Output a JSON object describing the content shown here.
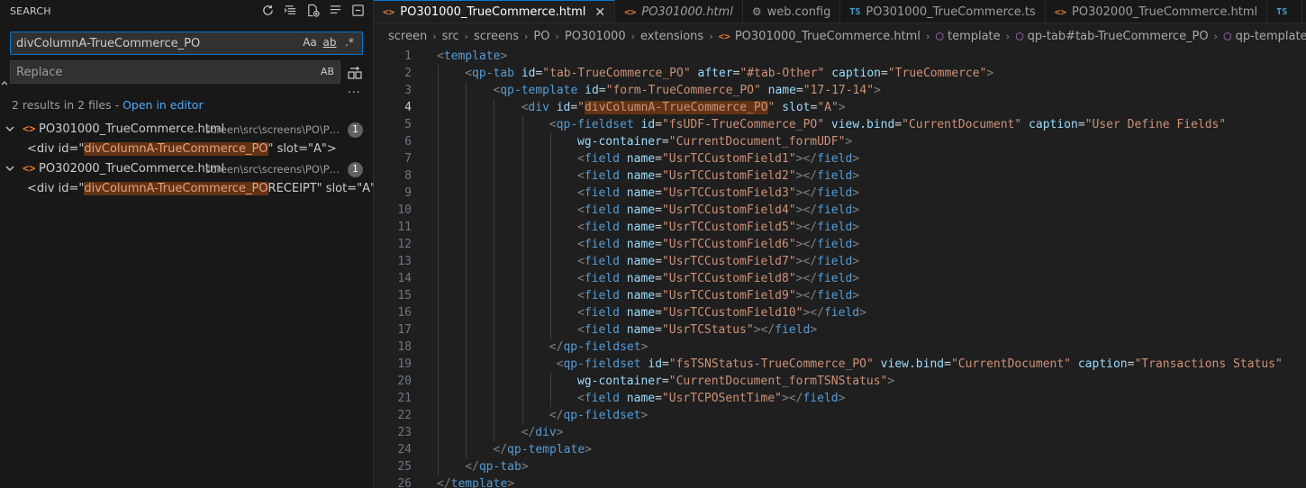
{
  "sidebar": {
    "title": "SEARCH",
    "search_value": "divColumnA-TrueCommerce_PO",
    "search_options": [
      "Aa",
      "ab",
      ".*"
    ],
    "replace_placeholder": "Replace",
    "replace_option": "AB",
    "more": "...",
    "results_text": "2 results in 2 files - ",
    "open_in_editor": "Open in editor",
    "files": [
      {
        "name": "PO301000_TrueCommerce.html",
        "path": "screen\\src\\screens\\PO\\PO3...",
        "count": "1",
        "match_prefix": "<div id=\"",
        "match_hl": "divColumnA-TrueCommerce_PO",
        "match_suffix": "\" slot=\"A\">"
      },
      {
        "name": "PO302000_TrueCommerce.html",
        "path": "screen\\src\\screens\\PO\\PO3...",
        "count": "1",
        "match_prefix": "<div id=\"",
        "match_hl": "divColumnA-TrueCommerce_PO",
        "match_suffix": "RECEIPT\" slot=\"A\">"
      }
    ]
  },
  "tabs": [
    {
      "icon": "<>",
      "icon_type": "html",
      "label": "PO301000_TrueCommerce.html",
      "active": true,
      "italic": false
    },
    {
      "icon": "<>",
      "icon_type": "html",
      "label": "PO301000.html",
      "active": false,
      "italic": true
    },
    {
      "icon": "⚙",
      "icon_type": "gear",
      "label": "web.config",
      "active": false,
      "italic": false
    },
    {
      "icon": "TS",
      "icon_type": "ts",
      "label": "PO301000_TrueCommerce.ts",
      "active": false,
      "italic": false
    },
    {
      "icon": "<>",
      "icon_type": "html",
      "label": "PO302000_TrueCommerce.html",
      "active": false,
      "italic": false
    },
    {
      "icon": "TS",
      "icon_type": "ts",
      "label": "",
      "active": false,
      "italic": false
    }
  ],
  "breadcrumb": [
    "screen",
    "src",
    "screens",
    "PO",
    "PO301000",
    "extensions",
    "PO301000_TrueCommerce.html",
    "template",
    "qp-tab#tab-TrueCommerce_PO",
    "qp-template#form-TrueCo"
  ],
  "current_line": 4,
  "code_lines": [
    {
      "n": "1",
      "indent": 0,
      "tokens": [
        [
          "br",
          "<"
        ],
        [
          "tag",
          "template"
        ],
        [
          "br",
          ">"
        ]
      ]
    },
    {
      "n": "2",
      "indent": 1,
      "tokens": [
        [
          "br",
          "<"
        ],
        [
          "tag",
          "qp-tab"
        ],
        [
          "sp",
          " "
        ],
        [
          "attr",
          "id"
        ],
        [
          "eq",
          "="
        ],
        [
          "str",
          "\"tab-TrueCommerce_PO\""
        ],
        [
          "sp",
          " "
        ],
        [
          "attr",
          "after"
        ],
        [
          "eq",
          "="
        ],
        [
          "str",
          "\"#tab-Other\""
        ],
        [
          "sp",
          " "
        ],
        [
          "attr",
          "caption"
        ],
        [
          "eq",
          "="
        ],
        [
          "str",
          "\"TrueCommerce\""
        ],
        [
          "br",
          ">"
        ]
      ]
    },
    {
      "n": "3",
      "indent": 2,
      "tokens": [
        [
          "br",
          "<"
        ],
        [
          "tag",
          "qp-template"
        ],
        [
          "sp",
          " "
        ],
        [
          "attr",
          "id"
        ],
        [
          "eq",
          "="
        ],
        [
          "str",
          "\"form-TrueCommerce_PO\""
        ],
        [
          "sp",
          " "
        ],
        [
          "attr",
          "name"
        ],
        [
          "eq",
          "="
        ],
        [
          "str",
          "\"17-17-14\""
        ],
        [
          "br",
          ">"
        ]
      ]
    },
    {
      "n": "4",
      "indent": 3,
      "tokens": [
        [
          "br",
          "<"
        ],
        [
          "tag",
          "div"
        ],
        [
          "sp",
          " "
        ],
        [
          "attr",
          "id"
        ],
        [
          "eq",
          "="
        ],
        [
          "str",
          "\""
        ],
        [
          "hl",
          "divColumnA-TrueCommerce_PO"
        ],
        [
          "str",
          "\""
        ],
        [
          "sp",
          " "
        ],
        [
          "attr",
          "slot"
        ],
        [
          "eq",
          "="
        ],
        [
          "str",
          "\"A\""
        ],
        [
          "br",
          ">"
        ]
      ]
    },
    {
      "n": "5",
      "indent": 4,
      "tokens": [
        [
          "br",
          "<"
        ],
        [
          "tag",
          "qp-fieldset"
        ],
        [
          "sp",
          " "
        ],
        [
          "attr",
          "id"
        ],
        [
          "eq",
          "="
        ],
        [
          "str",
          "\"fsUDF-TrueCommerce_PO\""
        ],
        [
          "sp",
          " "
        ],
        [
          "attr",
          "view.bind"
        ],
        [
          "eq",
          "="
        ],
        [
          "str",
          "\"CurrentDocument\""
        ],
        [
          "sp",
          " "
        ],
        [
          "attr",
          "caption"
        ],
        [
          "eq",
          "="
        ],
        [
          "str",
          "\"User Define Fields\""
        ]
      ]
    },
    {
      "n": "6",
      "indent": 5,
      "tokens": [
        [
          "attr",
          "wg-container"
        ],
        [
          "eq",
          "="
        ],
        [
          "str",
          "\"CurrentDocument_formUDF\""
        ],
        [
          "br",
          ">"
        ]
      ]
    },
    {
      "n": "7",
      "indent": 5,
      "tokens": [
        [
          "br",
          "<"
        ],
        [
          "tag",
          "field"
        ],
        [
          "sp",
          " "
        ],
        [
          "attr",
          "name"
        ],
        [
          "eq",
          "="
        ],
        [
          "str",
          "\"UsrTCCustomField1\""
        ],
        [
          "br",
          "></"
        ],
        [
          "tag",
          "field"
        ],
        [
          "br",
          ">"
        ]
      ]
    },
    {
      "n": "8",
      "indent": 5,
      "tokens": [
        [
          "br",
          "<"
        ],
        [
          "tag",
          "field"
        ],
        [
          "sp",
          " "
        ],
        [
          "attr",
          "name"
        ],
        [
          "eq",
          "="
        ],
        [
          "str",
          "\"UsrTCCustomField2\""
        ],
        [
          "br",
          "></"
        ],
        [
          "tag",
          "field"
        ],
        [
          "br",
          ">"
        ]
      ]
    },
    {
      "n": "9",
      "indent": 5,
      "tokens": [
        [
          "br",
          "<"
        ],
        [
          "tag",
          "field"
        ],
        [
          "sp",
          " "
        ],
        [
          "attr",
          "name"
        ],
        [
          "eq",
          "="
        ],
        [
          "str",
          "\"UsrTCCustomField3\""
        ],
        [
          "br",
          "></"
        ],
        [
          "tag",
          "field"
        ],
        [
          "br",
          ">"
        ]
      ]
    },
    {
      "n": "10",
      "indent": 5,
      "tokens": [
        [
          "br",
          "<"
        ],
        [
          "tag",
          "field"
        ],
        [
          "sp",
          " "
        ],
        [
          "attr",
          "name"
        ],
        [
          "eq",
          "="
        ],
        [
          "str",
          "\"UsrTCCustomField4\""
        ],
        [
          "br",
          "></"
        ],
        [
          "tag",
          "field"
        ],
        [
          "br",
          ">"
        ]
      ]
    },
    {
      "n": "11",
      "indent": 5,
      "tokens": [
        [
          "br",
          "<"
        ],
        [
          "tag",
          "field"
        ],
        [
          "sp",
          " "
        ],
        [
          "attr",
          "name"
        ],
        [
          "eq",
          "="
        ],
        [
          "str",
          "\"UsrTCCustomField5\""
        ],
        [
          "br",
          "></"
        ],
        [
          "tag",
          "field"
        ],
        [
          "br",
          ">"
        ]
      ]
    },
    {
      "n": "12",
      "indent": 5,
      "tokens": [
        [
          "br",
          "<"
        ],
        [
          "tag",
          "field"
        ],
        [
          "sp",
          " "
        ],
        [
          "attr",
          "name"
        ],
        [
          "eq",
          "="
        ],
        [
          "str",
          "\"UsrTCCustomField6\""
        ],
        [
          "br",
          "></"
        ],
        [
          "tag",
          "field"
        ],
        [
          "br",
          ">"
        ]
      ]
    },
    {
      "n": "13",
      "indent": 5,
      "tokens": [
        [
          "br",
          "<"
        ],
        [
          "tag",
          "field"
        ],
        [
          "sp",
          " "
        ],
        [
          "attr",
          "name"
        ],
        [
          "eq",
          "="
        ],
        [
          "str",
          "\"UsrTCCustomField7\""
        ],
        [
          "br",
          "></"
        ],
        [
          "tag",
          "field"
        ],
        [
          "br",
          ">"
        ]
      ]
    },
    {
      "n": "14",
      "indent": 5,
      "tokens": [
        [
          "br",
          "<"
        ],
        [
          "tag",
          "field"
        ],
        [
          "sp",
          " "
        ],
        [
          "attr",
          "name"
        ],
        [
          "eq",
          "="
        ],
        [
          "str",
          "\"UsrTCCustomField8\""
        ],
        [
          "br",
          "></"
        ],
        [
          "tag",
          "field"
        ],
        [
          "br",
          ">"
        ]
      ]
    },
    {
      "n": "15",
      "indent": 5,
      "tokens": [
        [
          "br",
          "<"
        ],
        [
          "tag",
          "field"
        ],
        [
          "sp",
          " "
        ],
        [
          "attr",
          "name"
        ],
        [
          "eq",
          "="
        ],
        [
          "str",
          "\"UsrTCCustomField9\""
        ],
        [
          "br",
          "></"
        ],
        [
          "tag",
          "field"
        ],
        [
          "br",
          ">"
        ]
      ]
    },
    {
      "n": "16",
      "indent": 5,
      "tokens": [
        [
          "br",
          "<"
        ],
        [
          "tag",
          "field"
        ],
        [
          "sp",
          " "
        ],
        [
          "attr",
          "name"
        ],
        [
          "eq",
          "="
        ],
        [
          "str",
          "\"UsrTCCustomField10\""
        ],
        [
          "br",
          "></"
        ],
        [
          "tag",
          "field"
        ],
        [
          "br",
          ">"
        ]
      ]
    },
    {
      "n": "17",
      "indent": 5,
      "tokens": [
        [
          "br",
          "<"
        ],
        [
          "tag",
          "field"
        ],
        [
          "sp",
          " "
        ],
        [
          "attr",
          "name"
        ],
        [
          "eq",
          "="
        ],
        [
          "str",
          "\"UsrTCStatus\""
        ],
        [
          "br",
          "></"
        ],
        [
          "tag",
          "field"
        ],
        [
          "br",
          ">"
        ]
      ]
    },
    {
      "n": "18",
      "indent": 4,
      "tokens": [
        [
          "br",
          "</"
        ],
        [
          "tag",
          "qp-fieldset"
        ],
        [
          "br",
          ">"
        ]
      ]
    },
    {
      "n": "19",
      "indent": 4,
      "lead": " ",
      "tokens": [
        [
          "br",
          "<"
        ],
        [
          "tag",
          "qp-fieldset"
        ],
        [
          "sp",
          " "
        ],
        [
          "attr",
          "id"
        ],
        [
          "eq",
          "="
        ],
        [
          "str",
          "\"fsTSNStatus-TrueCommerce_PO\""
        ],
        [
          "sp",
          " "
        ],
        [
          "attr",
          "view.bind"
        ],
        [
          "eq",
          "="
        ],
        [
          "str",
          "\"CurrentDocument\""
        ],
        [
          "sp",
          " "
        ],
        [
          "attr",
          "caption"
        ],
        [
          "eq",
          "="
        ],
        [
          "str",
          "\"Transactions Status\""
        ]
      ]
    },
    {
      "n": "20",
      "indent": 5,
      "tokens": [
        [
          "attr",
          "wg-container"
        ],
        [
          "eq",
          "="
        ],
        [
          "str",
          "\"CurrentDocument_formTSNStatus\""
        ],
        [
          "br",
          ">"
        ]
      ]
    },
    {
      "n": "21",
      "indent": 5,
      "tokens": [
        [
          "br",
          "<"
        ],
        [
          "tag",
          "field"
        ],
        [
          "sp",
          " "
        ],
        [
          "attr",
          "name"
        ],
        [
          "eq",
          "="
        ],
        [
          "str",
          "\"UsrTCPOSentTime\""
        ],
        [
          "br",
          "></"
        ],
        [
          "tag",
          "field"
        ],
        [
          "br",
          ">"
        ]
      ]
    },
    {
      "n": "22",
      "indent": 4,
      "tokens": [
        [
          "br",
          "</"
        ],
        [
          "tag",
          "qp-fieldset"
        ],
        [
          "br",
          ">"
        ]
      ]
    },
    {
      "n": "23",
      "indent": 3,
      "tokens": [
        [
          "br",
          "</"
        ],
        [
          "tag",
          "div"
        ],
        [
          "br",
          ">"
        ]
      ]
    },
    {
      "n": "24",
      "indent": 2,
      "tokens": [
        [
          "br",
          "</"
        ],
        [
          "tag",
          "qp-template"
        ],
        [
          "br",
          ">"
        ]
      ]
    },
    {
      "n": "25",
      "indent": 1,
      "tokens": [
        [
          "br",
          "</"
        ],
        [
          "tag",
          "qp-tab"
        ],
        [
          "br",
          ">"
        ]
      ]
    },
    {
      "n": "26",
      "indent": 0,
      "tokens": [
        [
          "br",
          "</"
        ],
        [
          "tag",
          "template"
        ],
        [
          "br",
          ">"
        ]
      ]
    }
  ]
}
